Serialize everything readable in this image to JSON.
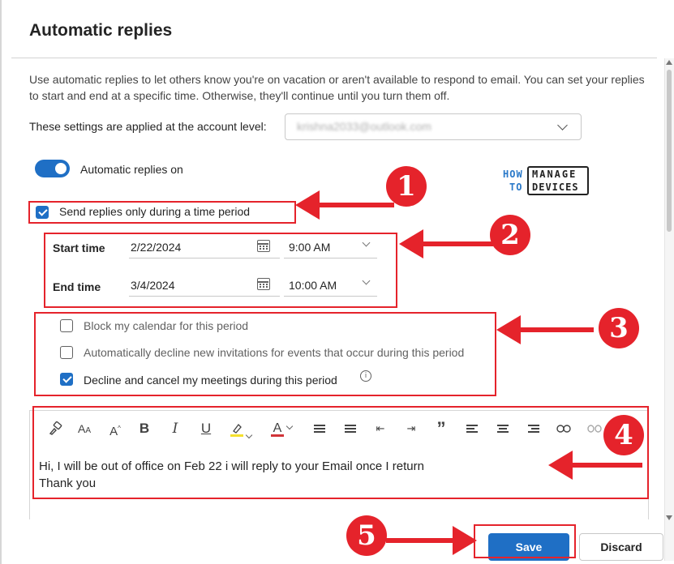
{
  "dialog": {
    "title": "Automatic replies",
    "description": "Use automatic replies to let others know you're on vacation or aren't available to respond to email. You can set your replies to start and end at a specific time. Otherwise, they'll continue until you turn them off."
  },
  "account": {
    "label": "These settings are applied at the account level:",
    "value": "krishna2033@outlook.com"
  },
  "toggle": {
    "label": "Automatic replies on",
    "on": true
  },
  "logo": {
    "how": "HOW",
    "to": "TO",
    "manage": "MANAGE",
    "devices": "DEVICES"
  },
  "time_period": {
    "label": "Send replies only during a time period",
    "checked": true
  },
  "schedule": {
    "start_label": "Start time",
    "start_date": "2/22/2024",
    "start_time": "9:00 AM",
    "end_label": "End time",
    "end_date": "3/4/2024",
    "end_time": "10:00 AM"
  },
  "options": [
    {
      "label": "Block my calendar for this period",
      "checked": false
    },
    {
      "label": "Automatically decline new invitations for events that occur during this period",
      "checked": false
    },
    {
      "label": "Decline and cancel my meetings during this period",
      "checked": true
    }
  ],
  "toolbar": {
    "icons": [
      "format-painter-icon",
      "font-size-icon",
      "increase-font-icon",
      "bold-icon",
      "italic-icon",
      "underline-icon",
      "highlight-icon",
      "font-color-icon",
      "bullets-icon",
      "numbering-icon",
      "decrease-indent-icon",
      "increase-indent-icon",
      "quote-icon",
      "align-left-icon",
      "align-center-icon",
      "align-right-icon",
      "link-icon",
      "unlink-icon"
    ],
    "bold": "B",
    "italic": "I",
    "underline": "U",
    "quote": "”",
    "font_size": "A",
    "font_color": "A"
  },
  "message": {
    "line1": "Hi, I will be out of office on Feb 22 i will reply to your Email once I return",
    "line2": "Thank you"
  },
  "buttons": {
    "save": "Save",
    "discard": "Discard"
  },
  "annotations": {
    "accent": "#e5232b",
    "numbers": [
      "1",
      "2",
      "3",
      "4",
      "5"
    ]
  }
}
